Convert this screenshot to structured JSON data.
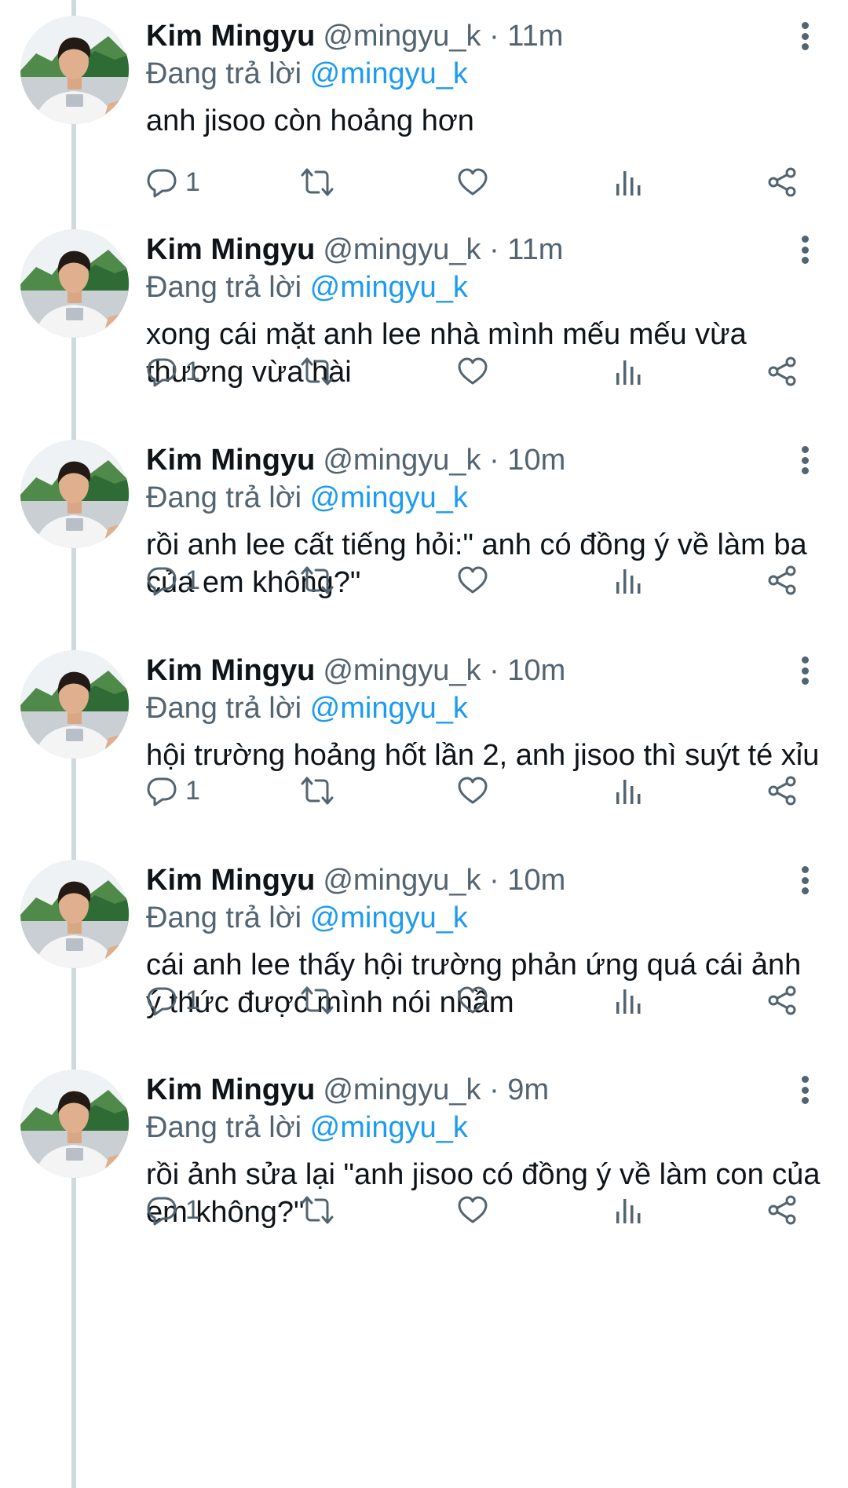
{
  "tweets": [
    {
      "name": "Kim Mingyu",
      "handle_time": "@mingyu_k · 11m",
      "reply_prefix": "Đang trả lời",
      "reply_mention": "@mingyu_k",
      "text": "anh jisoo còn hoảng hơn",
      "reply_count": "1"
    },
    {
      "name": "Kim Mingyu",
      "handle_time": "@mingyu_k · 11m",
      "reply_prefix": "Đang trả lời",
      "reply_mention": "@mingyu_k",
      "text": "xong cái mặt anh lee nhà mình mếu mếu vừa thương vừa hài",
      "reply_count": "1"
    },
    {
      "name": "Kim Mingyu",
      "handle_time": "@mingyu_k · 10m",
      "reply_prefix": "Đang trả lời",
      "reply_mention": "@mingyu_k",
      "text": "rồi anh lee cất tiếng hỏi:\" anh có đồng ý về làm ba của em không?\"",
      "reply_count": "1"
    },
    {
      "name": "Kim Mingyu",
      "handle_time": "@mingyu_k · 10m",
      "reply_prefix": "Đang trả lời",
      "reply_mention": "@mingyu_k",
      "text": "hội trường hoảng hốt lần 2, anh jisoo thì suýt té xỉu",
      "reply_count": "1"
    },
    {
      "name": "Kim Mingyu",
      "handle_time": "@mingyu_k · 10m",
      "reply_prefix": "Đang trả lời",
      "reply_mention": "@mingyu_k",
      "text": "cái anh lee thấy hội trường phản ứng quá cái ảnh ý thức được mình nói nhầm",
      "reply_count": "1"
    },
    {
      "name": "Kim Mingyu",
      "handle_time": "@mingyu_k · 9m",
      "reply_prefix": "Đang trả lời",
      "reply_mention": "@mingyu_k",
      "text": "rồi ảnh sửa lại \"anh jisoo có đồng ý về làm con của em không?\"",
      "reply_count": "1"
    }
  ],
  "icons": {
    "reply": "reply-bubble-icon",
    "retweet": "retweet-icon",
    "like": "heart-icon",
    "views": "analytics-icon",
    "share": "share-icon",
    "more": "more-vertical-icon"
  },
  "colors": {
    "text": "#0f1419",
    "secondary": "#536471",
    "mention": "#1d9bf0",
    "thread_line": "#cfd9de",
    "background": "#ffffff"
  }
}
